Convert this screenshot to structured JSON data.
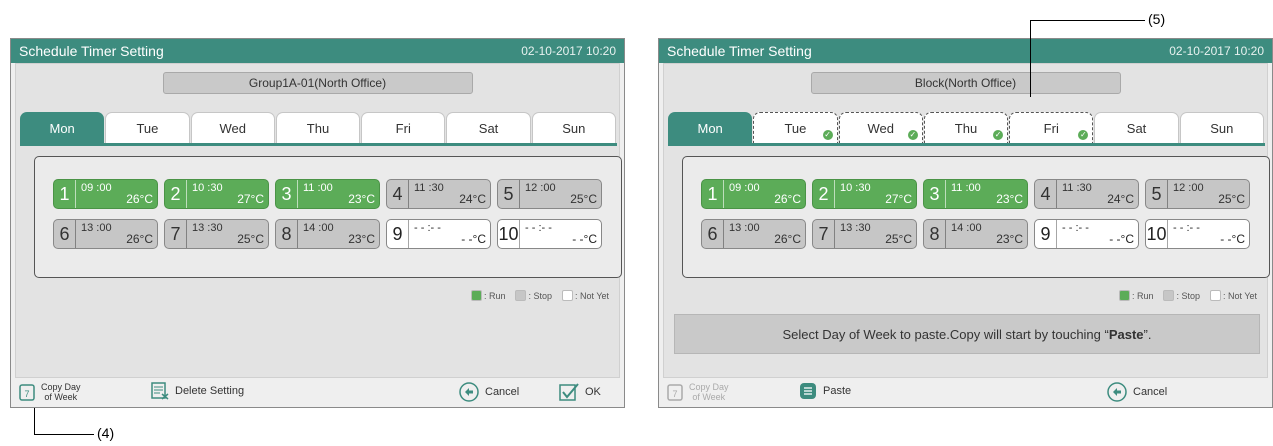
{
  "left": {
    "title": "Schedule Timer Setting",
    "datetime": "02-10-2017   10:20",
    "group": "Group1A-01(North Office)",
    "days": [
      "Mon",
      "Tue",
      "Wed",
      "Thu",
      "Fri",
      "Sat",
      "Sun"
    ],
    "slots": [
      {
        "num": "1",
        "time": "09 :00",
        "temp": "26°C",
        "state": "run"
      },
      {
        "num": "2",
        "time": "10 :30",
        "temp": "27°C",
        "state": "run"
      },
      {
        "num": "3",
        "time": "11 :00",
        "temp": "23°C",
        "state": "run"
      },
      {
        "num": "4",
        "time": "11 :30",
        "temp": "24°C",
        "state": "stop"
      },
      {
        "num": "5",
        "time": "12 :00",
        "temp": "25°C",
        "state": "stop"
      },
      {
        "num": "6",
        "time": "13 :00",
        "temp": "26°C",
        "state": "stop"
      },
      {
        "num": "7",
        "time": "13 :30",
        "temp": "25°C",
        "state": "stop"
      },
      {
        "num": "8",
        "time": "14 :00",
        "temp": "23°C",
        "state": "stop"
      },
      {
        "num": "9",
        "time": "- - :- -",
        "temp": "- -°C",
        "state": "notyet"
      },
      {
        "num": "10",
        "time": "- - :- -",
        "temp": "- -°C",
        "state": "notyet"
      }
    ],
    "legend": {
      "run": ": Run",
      "stop": ": Stop",
      "notyet": ": Not Yet"
    },
    "bottom": {
      "copy_line1": "Copy Day",
      "copy_line2": "of Week",
      "delete": "Delete Setting",
      "cancel": "Cancel",
      "ok": "OK"
    }
  },
  "right": {
    "title": "Schedule Timer Setting",
    "datetime": "02-10-2017   10:20",
    "group": "Block(North Office)",
    "days": [
      "Mon",
      "Tue",
      "Wed",
      "Thu",
      "Fri",
      "Sat",
      "Sun"
    ],
    "slots": [
      {
        "num": "1",
        "time": "09 :00",
        "temp": "26°C",
        "state": "run"
      },
      {
        "num": "2",
        "time": "10 :30",
        "temp": "27°C",
        "state": "run"
      },
      {
        "num": "3",
        "time": "11 :00",
        "temp": "23°C",
        "state": "run"
      },
      {
        "num": "4",
        "time": "11 :30",
        "temp": "24°C",
        "state": "stop"
      },
      {
        "num": "5",
        "time": "12 :00",
        "temp": "25°C",
        "state": "stop"
      },
      {
        "num": "6",
        "time": "13 :00",
        "temp": "26°C",
        "state": "stop"
      },
      {
        "num": "7",
        "time": "13 :30",
        "temp": "25°C",
        "state": "stop"
      },
      {
        "num": "8",
        "time": "14 :00",
        "temp": "23°C",
        "state": "stop"
      },
      {
        "num": "9",
        "time": "- - :- -",
        "temp": "- -°C",
        "state": "notyet"
      },
      {
        "num": "10",
        "time": "- - :- -",
        "temp": "- -°C",
        "state": "notyet"
      }
    ],
    "legend": {
      "run": ": Run",
      "stop": ": Stop",
      "notyet": ": Not Yet"
    },
    "message_pre": "Select Day of Week to paste.Copy will start by touching “",
    "message_bold": "Paste",
    "message_post": "”.",
    "bottom": {
      "copy_line1": "Copy Day",
      "copy_line2": "of Week",
      "paste": "Paste",
      "cancel": "Cancel"
    }
  },
  "callouts": {
    "four": "(4)",
    "five": "(5)"
  },
  "colors": {
    "accent": "#3d8c7f",
    "run": "#5cac58",
    "stop": "#c6c6c6",
    "notyet": "#ffffff"
  }
}
